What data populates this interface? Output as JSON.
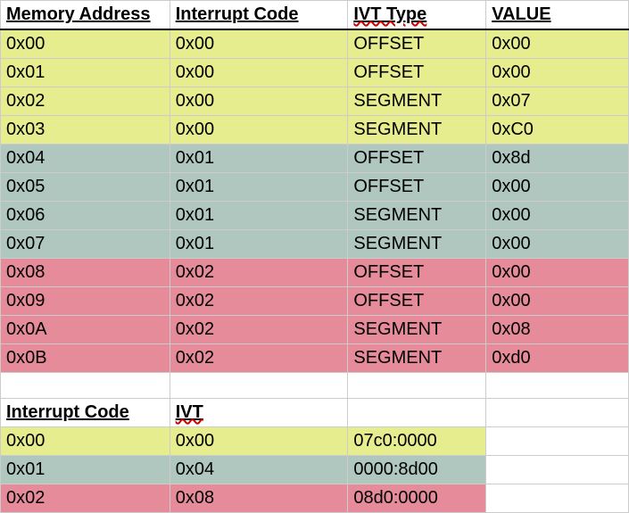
{
  "table1": {
    "headers": [
      "Memory Address",
      "Interrupt Code",
      "IVT Type",
      "VALUE"
    ],
    "rows": [
      {
        "color": "yellow",
        "cells": [
          "0x00",
          "0x00",
          "OFFSET",
          "0x00"
        ]
      },
      {
        "color": "yellow",
        "cells": [
          "0x01",
          "0x00",
          "OFFSET",
          "0x00"
        ]
      },
      {
        "color": "yellow",
        "cells": [
          "0x02",
          "0x00",
          "SEGMENT",
          "0x07"
        ]
      },
      {
        "color": "yellow",
        "cells": [
          "0x03",
          "0x00",
          "SEGMENT",
          "0xC0"
        ]
      },
      {
        "color": "teal",
        "cells": [
          "0x04",
          "0x01",
          "OFFSET",
          "0x8d"
        ]
      },
      {
        "color": "teal",
        "cells": [
          "0x05",
          "0x01",
          "OFFSET",
          "0x00"
        ]
      },
      {
        "color": "teal",
        "cells": [
          "0x06",
          "0x01",
          "SEGMENT",
          "0x00"
        ]
      },
      {
        "color": "teal",
        "cells": [
          "0x07",
          "0x01",
          "SEGMENT",
          "0x00"
        ]
      },
      {
        "color": "pink",
        "cells": [
          "0x08",
          "0x02",
          "OFFSET",
          "0x00"
        ]
      },
      {
        "color": "pink",
        "cells": [
          "0x09",
          "0x02",
          "OFFSET",
          "0x00"
        ]
      },
      {
        "color": "pink",
        "cells": [
          "0x0A",
          "0x02",
          "SEGMENT",
          "0x08"
        ]
      },
      {
        "color": "pink",
        "cells": [
          "0x0B",
          "0x02",
          "SEGMENT",
          "0xd0"
        ]
      }
    ]
  },
  "table2": {
    "headers": [
      "Interrupt Code",
      "IVT",
      "",
      ""
    ],
    "rows": [
      {
        "color": "yellow",
        "cells": [
          "0x00",
          "0x00",
          "07c0:0000",
          ""
        ]
      },
      {
        "color": "teal",
        "cells": [
          "0x01",
          "0x04",
          "0000:8d00",
          ""
        ]
      },
      {
        "color": "pink",
        "cells": [
          "0x02",
          "0x08",
          "08d0:0000",
          ""
        ]
      }
    ]
  }
}
